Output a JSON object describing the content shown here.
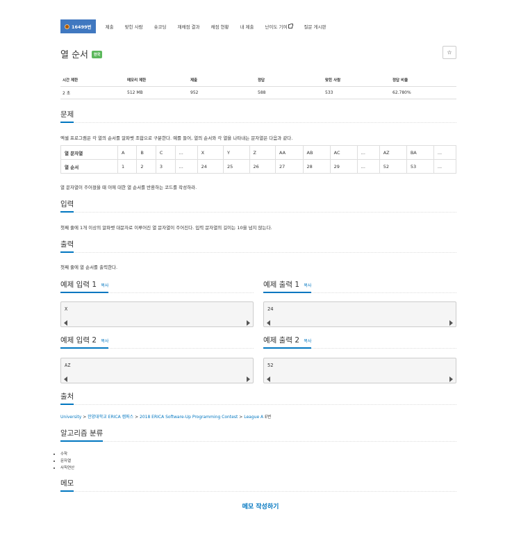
{
  "nav": {
    "problem_number": "16499번",
    "items": [
      "제출",
      "맞힌 사람",
      "숏코딩",
      "재채점 결과",
      "채점 현황",
      "내 제출",
      "난이도 기여",
      "질문 게시판"
    ]
  },
  "problem": {
    "title": "열 순서",
    "badge": "한국",
    "star": "☆"
  },
  "info": {
    "headers": [
      "시간 제한",
      "메모리 제한",
      "제출",
      "정답",
      "맞힌 사람",
      "정답 비율"
    ],
    "values": [
      "2 초",
      "512 MB",
      "952",
      "588",
      "533",
      "62.780%"
    ]
  },
  "sections": {
    "problem": "문제",
    "input": "입력",
    "output": "출력",
    "source": "출처",
    "algorithm": "알고리즘 분류",
    "memo": "메모"
  },
  "problem_text": {
    "intro": "엑셀 프로그램은 각 열의 순서를 알파벳 조합으로 구분한다. 예를 들어, 열의 순서와 각 열을 나타내는 문자열은 다음과 같다.",
    "after": "열 문자열이 주어졌을 때 이에 대한 열 순서를 반환하는 코드를 작성하라."
  },
  "column_table": {
    "row1_label": "열 문자열",
    "row1": [
      "A",
      "B",
      "C",
      "...",
      "X",
      "Y",
      "Z",
      "AA",
      "AB",
      "AC",
      "...",
      "AZ",
      "BA",
      "..."
    ],
    "row2_label": "열 순서",
    "row2": [
      "1",
      "2",
      "3",
      "...",
      "24",
      "25",
      "26",
      "27",
      "28",
      "29",
      "...",
      "52",
      "53",
      "..."
    ]
  },
  "input_text": "첫째 줄에 1개 이상의 알파벳 대문자로 이루어진 열 문자열이 주어진다. 입력 문자열의 길이는 10을 넘지 않는다.",
  "output_text": "첫째 줄에 열 순서를 출력한다.",
  "samples": {
    "copy_label": "복사",
    "in1_title": "예제 입력 1",
    "out1_title": "예제 출력 1",
    "in2_title": "예제 입력 2",
    "out2_title": "예제 출력 2",
    "in1": "X",
    "out1": "24",
    "in2": "AZ",
    "out2": "52"
  },
  "source": {
    "university": "University",
    "school": "한양대학교 ERICA 캠퍼스",
    "contest": "2018 ERICA Software-Up Programming Contest",
    "league": "League A",
    "problem_id": "E번"
  },
  "tags": [
    "수학",
    "문자열",
    "사칙연산"
  ],
  "memo_link": "메모 작성하기"
}
